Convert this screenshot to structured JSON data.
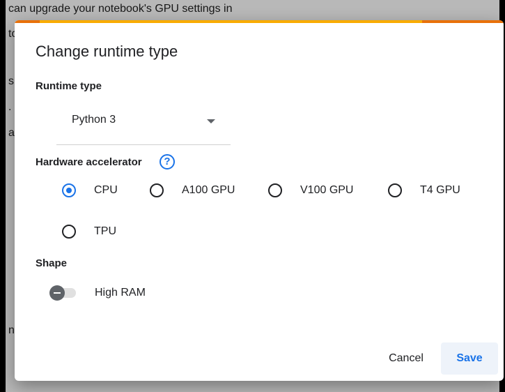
{
  "background": {
    "lines": [
      "can upgrade your notebook's GPU settings in",
      "to",
      "s",
      ".",
      "ar",
      "n"
    ]
  },
  "dialog": {
    "title": "Change runtime type",
    "runtime_type": {
      "label": "Runtime type",
      "selected": "Python 3"
    },
    "hardware_accelerator": {
      "label": "Hardware accelerator",
      "help_glyph": "?",
      "options": [
        {
          "label": "CPU",
          "selected": true
        },
        {
          "label": "A100 GPU",
          "selected": false
        },
        {
          "label": "V100 GPU",
          "selected": false
        },
        {
          "label": "T4 GPU",
          "selected": false
        },
        {
          "label": "TPU",
          "selected": false
        }
      ]
    },
    "shape": {
      "label": "Shape",
      "high_ram_label": "High RAM",
      "high_ram_enabled": false
    },
    "buttons": {
      "cancel": "Cancel",
      "save": "Save"
    }
  },
  "colors": {
    "accent_blue": "#1a73e8",
    "accent_orange": "#e8710a",
    "accent_yellow": "#f9ab00"
  }
}
